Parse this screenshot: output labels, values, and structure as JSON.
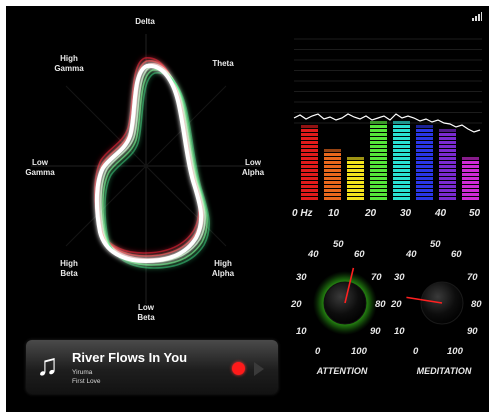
{
  "radar": {
    "labels": {
      "delta": "Delta",
      "theta": "Theta",
      "low_alpha": "Low\nAlpha",
      "high_alpha": "High\nAlpha",
      "low_beta": "Low\nBeta",
      "high_beta": "High\nBeta",
      "low_gamma": "Low\nGamma",
      "high_gamma": "High\nGamma"
    }
  },
  "equalizer": {
    "freq_labels": [
      "0 Hz",
      "10",
      "20",
      "30",
      "40",
      "50"
    ],
    "bands": [
      {
        "color": "#e01b1b",
        "level": 0.81
      },
      {
        "color": "#e8671c",
        "level": 0.55
      },
      {
        "color": "#f2e21d",
        "level": 0.45
      },
      {
        "color": "#55e63a",
        "level": 0.84
      },
      {
        "color": "#29e0d2",
        "level": 0.84
      },
      {
        "color": "#2a36e6",
        "level": 0.78
      },
      {
        "color": "#7a2bd0",
        "level": 0.76
      },
      {
        "color": "#cf2bd6",
        "level": 0.45
      }
    ]
  },
  "attention_dial": {
    "ticks": [
      "0",
      "10",
      "20",
      "30",
      "40",
      "50",
      "60",
      "70",
      "80",
      "90",
      "100"
    ],
    "title": "ATTENTION",
    "value": 55,
    "glow_color": "#3dd01a"
  },
  "meditation_dial": {
    "ticks": [
      "0",
      "10",
      "20",
      "30",
      "40",
      "50",
      "60",
      "70",
      "80",
      "90",
      "100"
    ],
    "title": "MEDITATION",
    "value": 20
  },
  "player": {
    "title": "River Flows In You",
    "artist": "Yiruma",
    "album": "First Love",
    "note_icon": "♫"
  }
}
